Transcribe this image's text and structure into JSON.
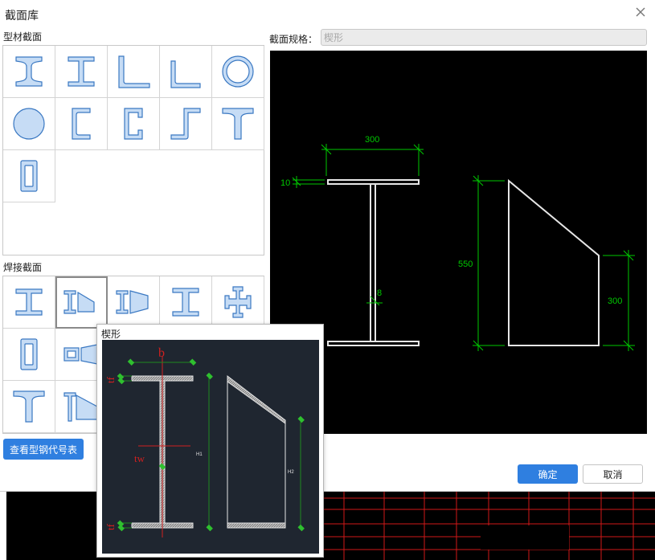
{
  "dialog": {
    "title": "截面库",
    "close_icon": "close-icon"
  },
  "profile_section": {
    "label": "型材截面",
    "items": [
      {
        "icon": "i-beam-icon"
      },
      {
        "icon": "h-beam-icon"
      },
      {
        "icon": "equal-angle-icon"
      },
      {
        "icon": "unequal-angle-icon"
      },
      {
        "icon": "round-tube-icon"
      },
      {
        "icon": "round-bar-icon"
      },
      {
        "icon": "channel-icon"
      },
      {
        "icon": "lipped-channel-icon"
      },
      {
        "icon": "z-section-icon"
      },
      {
        "icon": "t-section-icon"
      },
      {
        "icon": "rect-tube-icon"
      }
    ]
  },
  "welded_section": {
    "label": "焊接截面",
    "items": [
      {
        "icon": "welded-h-icon"
      },
      {
        "icon": "wedge-h-icon",
        "selected": true
      },
      {
        "icon": "tapered-h-icon"
      },
      {
        "icon": "welded-i-icon"
      },
      {
        "icon": "cross-h-icon"
      },
      {
        "icon": "welded-box-icon"
      },
      {
        "icon": "welded-box-tapered-icon"
      },
      {
        "icon": "welded-t-icon"
      },
      {
        "icon": "welded-t-tapered-icon"
      }
    ]
  },
  "spec": {
    "label": "截面规格：",
    "value": "楔形"
  },
  "preview": {
    "flange_width": "300",
    "flange_thickness": "10",
    "web_thickness": "8",
    "height_large": "550",
    "height_small": "300",
    "line_color": "#e6e6e6",
    "dim_color": "#00c800"
  },
  "buttons": {
    "steel_table": "查看型钢代号表",
    "ok": "确定",
    "cancel": "取消"
  },
  "tooltip": {
    "title": "楔形",
    "label_b": "b",
    "label_tf_top": "tf",
    "label_tw": "tw",
    "label_tf_bottom": "tf",
    "label_h1": "H1",
    "label_h2": "H2"
  },
  "colors": {
    "accent": "#2f7fe0",
    "icon_fill": "#c6dcf5",
    "icon_stroke": "#3a78c2"
  }
}
